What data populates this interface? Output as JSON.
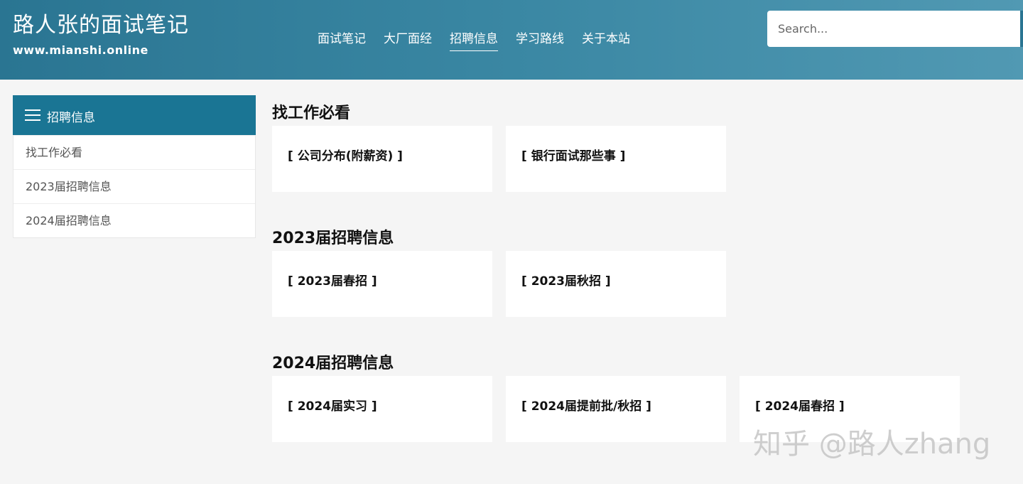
{
  "header": {
    "site_title": "路人张的面试笔记",
    "site_url": "www.mianshi.online",
    "nav": [
      {
        "label": "面试笔记"
      },
      {
        "label": "大厂面经"
      },
      {
        "label": "招聘信息",
        "active": true
      },
      {
        "label": "学习路线"
      },
      {
        "label": "关于本站"
      }
    ],
    "search_placeholder": "Search..."
  },
  "sidebar": {
    "title": "招聘信息",
    "items": [
      {
        "label": "找工作必看"
      },
      {
        "label": "2023届招聘信息"
      },
      {
        "label": "2024届招聘信息"
      }
    ]
  },
  "sections": [
    {
      "title": "找工作必看",
      "cards": [
        {
          "label": "[ 公司分布(附薪资) ]"
        },
        {
          "label": "[ 银行面试那些事 ]"
        }
      ]
    },
    {
      "title": "2023届招聘信息",
      "cards": [
        {
          "label": "[ 2023届春招 ]"
        },
        {
          "label": "[ 2023届秋招 ]"
        }
      ]
    },
    {
      "title": "2024届招聘信息",
      "cards": [
        {
          "label": "[ 2024届实习 ]"
        },
        {
          "label": "[ 2024届提前批/秋招 ]"
        },
        {
          "label": "[ 2024届春招 ]"
        }
      ]
    }
  ],
  "watermark": "知乎 @路人zhang",
  "colors": {
    "header_start": "#2a7592",
    "header_end": "#5199b3",
    "sidebar_head": "#1a7594",
    "page_bg": "#f5f5f5"
  },
  "icons": {
    "menu": "hamburger-menu-icon"
  }
}
